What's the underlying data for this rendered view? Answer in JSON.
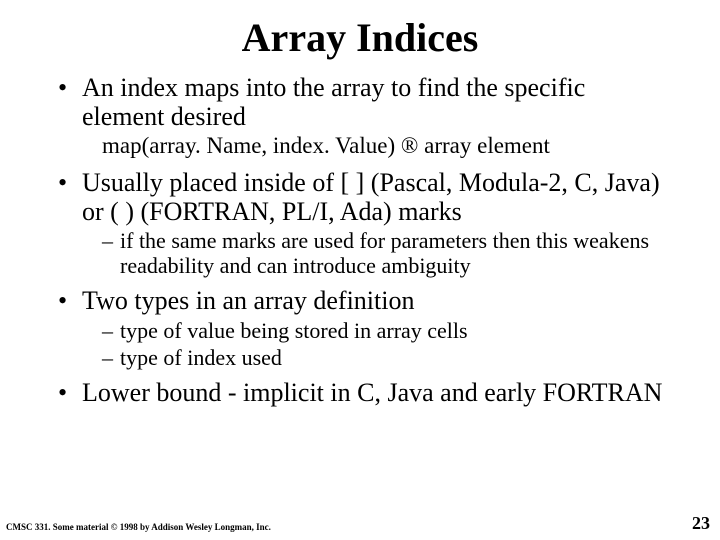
{
  "title": "Array Indices",
  "bullets": {
    "b1": "An index maps into the array to find the specific element desired",
    "b1_sub": "map(array. Name, index. Value)  →  array element",
    "b2": "Usually placed inside of [ ] (Pascal, Modula-2, C, Java) or ( ) (FORTRAN, PL/I, Ada) marks",
    "b2_sub1": "if the same marks are used for parameters then this weakens readability and can introduce ambiguity",
    "b3": "Two types in an array definition",
    "b3_sub1": "type of value being stored in array cells",
    "b3_sub2": "type of index used",
    "b4": "Lower bound - implicit in C, Java and early FORTRAN"
  },
  "footer": {
    "left": "CMSC 331. Some material © 1998 by Addison Wesley Longman, Inc.",
    "page": "23"
  }
}
